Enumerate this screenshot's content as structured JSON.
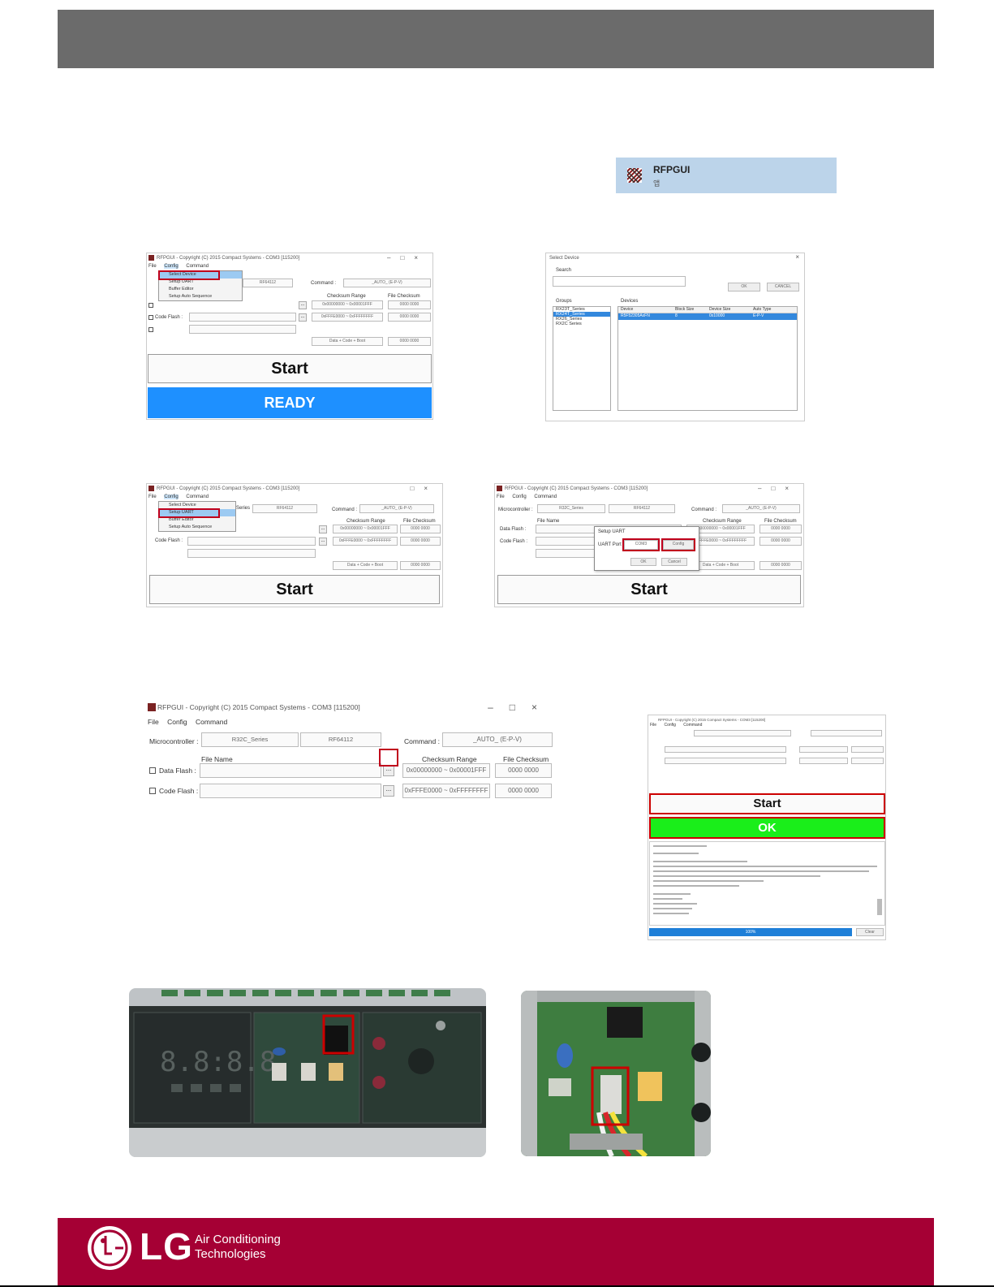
{
  "rfpgui_tile": {
    "title": "RFPGUI",
    "subtitle": "앱"
  },
  "screen1": {
    "title": "RFPGUI - Copyright (C) 2015 Compact Systems - COM3 [115200]",
    "menu": [
      "File",
      "Config",
      "Command"
    ],
    "dropdown": [
      "Select Device",
      "Setup UART",
      "Buffer Editor",
      "Setup Auto Sequence"
    ],
    "device_name": "RF64112",
    "command_label": "Command :",
    "command_value": "_AUTO_ (E-P-V)",
    "checksum_range_header": "Checksum Range",
    "file_checksum_header": "File Checksum",
    "data_flash_range": "0x00000000 ~ 0x00001FFF",
    "code_flash_label": "Code Flash :",
    "code_flash_range": "0xFFFE0000 ~ 0xFFFFFFFF",
    "checksum_zero": "0000 0000",
    "extra_range": "Data + Code + Boot",
    "start_label": "Start",
    "ready_label": "READY"
  },
  "screen2": {
    "title": "Select Device",
    "search_label": "Search",
    "ok": "OK",
    "cancel": "CANCEL",
    "groups_label": "Groups",
    "groups": [
      "RX23T_Series",
      "RX24T_Series",
      "RX26_Series",
      "RX2C Series"
    ],
    "devices_label": "Devices",
    "device_cols": [
      "Device",
      "Block Size",
      "Device Size",
      "Auto Type"
    ],
    "device_row": [
      "R5F52305AxFN",
      "8",
      "0x10000",
      "E-P-V"
    ]
  },
  "screen3": {
    "title": "RFPGUI - Copyright (C) 2015 Compact Systems - COM3 [115200]",
    "menu": [
      "File",
      "Config",
      "Command"
    ],
    "dropdown": [
      "Select Device",
      "Setup UART",
      "Buffer Editor",
      "Setup Auto Sequence"
    ],
    "device_series": "Series",
    "device_name": "RF64112",
    "command_label": "Command :",
    "command_value": "_AUTO_ (E-P-V)",
    "checksum_range_header": "Checksum Range",
    "file_checksum_header": "File Checksum",
    "data_flash_range": "0x00000000 ~ 0x00001FFF",
    "code_flash_label": "Code Flash :",
    "code_flash_range": "0xFFFE0000 ~ 0xFFFFFFFF",
    "checksum_zero": "0000 0000",
    "extra_range": "Data + Code + Boot",
    "start_label": "Start"
  },
  "screen4": {
    "title": "RFPGUI - Copyright (C) 2015 Compact Systems - COM3 [115200]",
    "menu": [
      "File",
      "Config",
      "Command"
    ],
    "micro_label": "Microcontroller :",
    "device_series": "R32C_Series",
    "device_name": "RF64112",
    "command_label": "Command :",
    "command_value": "_AUTO_ (E-P-V)",
    "file_name_header": "File Name",
    "checksum_range_header": "Checksum Range",
    "file_checksum_header": "File Checksum",
    "data_flash_label": "Data Flash :",
    "code_flash_label": "Code Flash :",
    "data_flash_range": "0x00000000 ~ 0x00001FFF",
    "code_flash_range": "0xFFFE0000 ~ 0xFFFFFFFF",
    "checksum_zero": "0000 0000",
    "extra_range": "Data + Code + Boot",
    "dialog_title": "Setup UART",
    "dialog_port_label": "UART Port",
    "dialog_port_value": "COM3",
    "dialog_config": "Config",
    "dialog_ok": "OK",
    "dialog_cancel": "Cancel",
    "start_label": "Start"
  },
  "screen5": {
    "title": "RFPGUI - Copyright (C) 2015 Compact Systems - COM3 [115200]",
    "menu": [
      "File",
      "Config",
      "Command"
    ],
    "micro_label": "Microcontroller :",
    "device_series": "R32C_Series",
    "device_name": "RF64112",
    "command_label": "Command :",
    "command_value": "_AUTO_ (E-P-V)",
    "file_name_header": "File Name",
    "checksum_range_header": "Checksum Range",
    "file_checksum_header": "File Checksum",
    "data_flash_label": "Data Flash :",
    "code_flash_label": "Code Flash :",
    "data_flash_range": "0x00000000 ~ 0x00001FFF",
    "code_flash_range": "0xFFFE0000 ~ 0xFFFFFFFF",
    "checksum_zero": "0000 0000"
  },
  "screen6": {
    "title": "RFPGUI - Copyright (C) 2015 Compact Systems - COM3 [115200]",
    "menu": [
      "File",
      "Config",
      "Command"
    ],
    "start_label": "Start",
    "ok_label": "OK",
    "progress_label": "100%",
    "progress_fraction": 1.0,
    "close_label": "Clear"
  },
  "footer": {
    "brand": "LG",
    "tagline_line1": "Air Conditioning",
    "tagline_line2": "Technologies",
    "background": "#a50034"
  }
}
